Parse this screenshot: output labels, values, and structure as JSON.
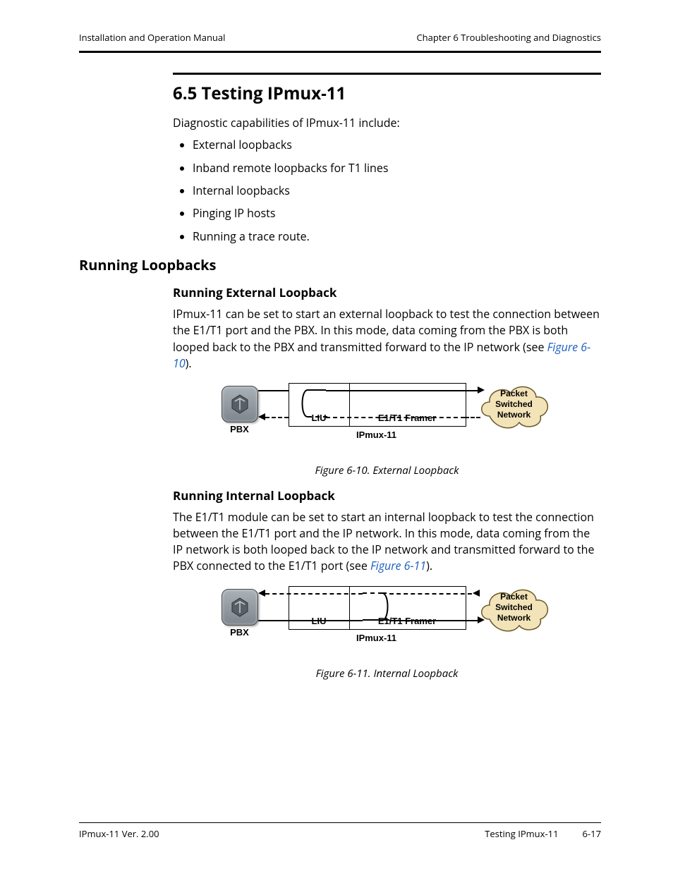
{
  "header": {
    "left": "Installation and Operation Manual",
    "right": "Chapter 6  Troubleshooting and Diagnostics"
  },
  "section": {
    "number_title": "6.5  Testing IPmux-11",
    "intro": "Diagnostic capabilities of IPmux-11 include:",
    "bullets": [
      "External loopbacks",
      "Inband remote loopbacks for T1 lines",
      "Internal loopbacks",
      "Pinging IP hosts",
      "Running a trace route."
    ]
  },
  "h2": "Running Loopbacks",
  "ext": {
    "heading": "Running External Loopback",
    "para_a": "IPmux-11 can be set to start an external loopback to test the connection between the E1/T1 port and the PBX. In this mode, data coming from the PBX is both looped back to the PBX and transmitted forward to the IP network (see ",
    "figref": "Figure 6-10",
    "para_b": ").",
    "caption": "Figure 6-10.  External Loopback"
  },
  "intl": {
    "heading": "Running Internal Loopback",
    "para_a": "The E1/T1 module can be set to start an internal loopback to test the connection between the E1/T1 port and the IP network. In this mode, data coming from the IP network is both looped back to the IP network and transmitted forward to the PBX connected to the E1/T1 port (see ",
    "figref": "Figure 6-11",
    "para_b": ").",
    "caption": "Figure 6-11.  Internal Loopback"
  },
  "diagram": {
    "pbx": "PBX",
    "liu": "LIU",
    "framer": "E1/T1 Framer",
    "device": "IPmux-11",
    "cloud_l1": "Packet",
    "cloud_l2": "Switched",
    "cloud_l3": "Network"
  },
  "footer": {
    "left": "IPmux-11 Ver. 2.00",
    "mid": "Testing IPmux-11",
    "page": "6-17"
  }
}
